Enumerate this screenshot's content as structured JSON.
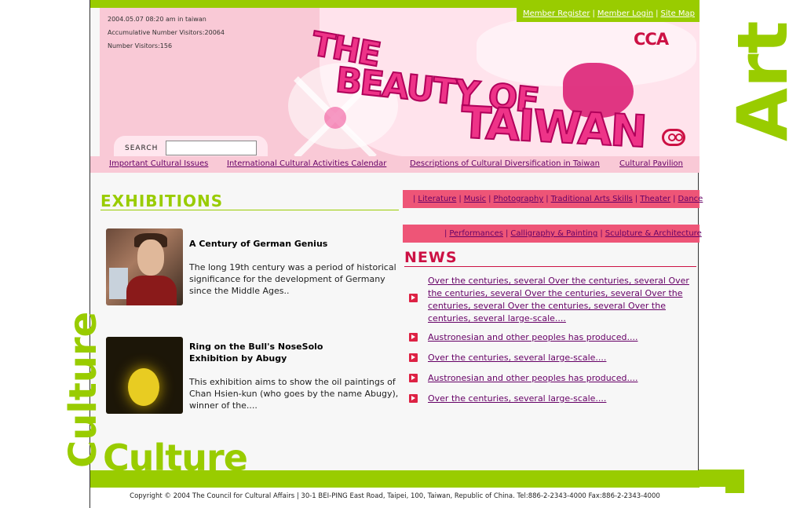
{
  "header": {
    "datetime": "2004.05.07 08:20 am in taiwan",
    "accumulative_visitors": "Accumulative Number Visitors:20064",
    "visitors": "Number Visitors:156",
    "top_links": [
      "Member Register",
      "Member Login",
      "Site Map"
    ],
    "brand": "CCA",
    "banner_title": [
      "THE",
      "BEAUTY OF",
      "TAIWAN"
    ]
  },
  "search": {
    "label": "SEARCH",
    "value": "",
    "placeholder": ""
  },
  "menu": [
    "Important Cultural Issues",
    "International Cultural Activities Calendar",
    "Descriptions of Cultural Diversification in Taiwan",
    "Cultural Pavilion"
  ],
  "exhibitions": {
    "heading": "EXHIBITIONS",
    "items": [
      {
        "title": "A Century of German Genius",
        "description": "The long 19th century was a period of historical significance for the development of Germany since the Middle Ages.."
      },
      {
        "title": "Ring on the Bull's NoseSolo Exhibition by Abugy",
        "description": "This exhibition aims to show the oil paintings of Chan Hsien-kun (who goes by the name Abugy), winner of the...."
      }
    ]
  },
  "categories": {
    "row1": [
      "Literature",
      "Music",
      "Photography",
      "Traditional Arts Skills",
      "Theater",
      "Dance"
    ],
    "row2": [
      "Performances",
      "Calligraphy & Painting",
      "Sculpture & Architecture"
    ]
  },
  "news": {
    "heading": "NEWS",
    "items": [
      "Over the centuries, several Over the centuries, several Over the centuries, several Over the centuries, several Over the centuries, several Over the centuries, several Over the centuries, several large-scale....",
      "Austronesian and other peoples has produced....",
      "Over the centuries, several large-scale....",
      "Austronesian and other peoples has produced....",
      "Over the centuries, several large-scale...."
    ]
  },
  "decor": {
    "culture_word": "Culture",
    "side_word": "Art"
  },
  "footer": {
    "copyright": "Copyright © 2004 The Council for Cultural Affairs | 30-1 BEI-PING East Road, Taipei, 100, Taiwan, Republic of China. Tel:886-2-2343-4000 Fax:886-2-2343-4000"
  },
  "colors": {
    "accent_green": "#99cc00",
    "accent_pink": "#ee5577",
    "news_red": "#cc1144",
    "link_purple": "#660066"
  }
}
